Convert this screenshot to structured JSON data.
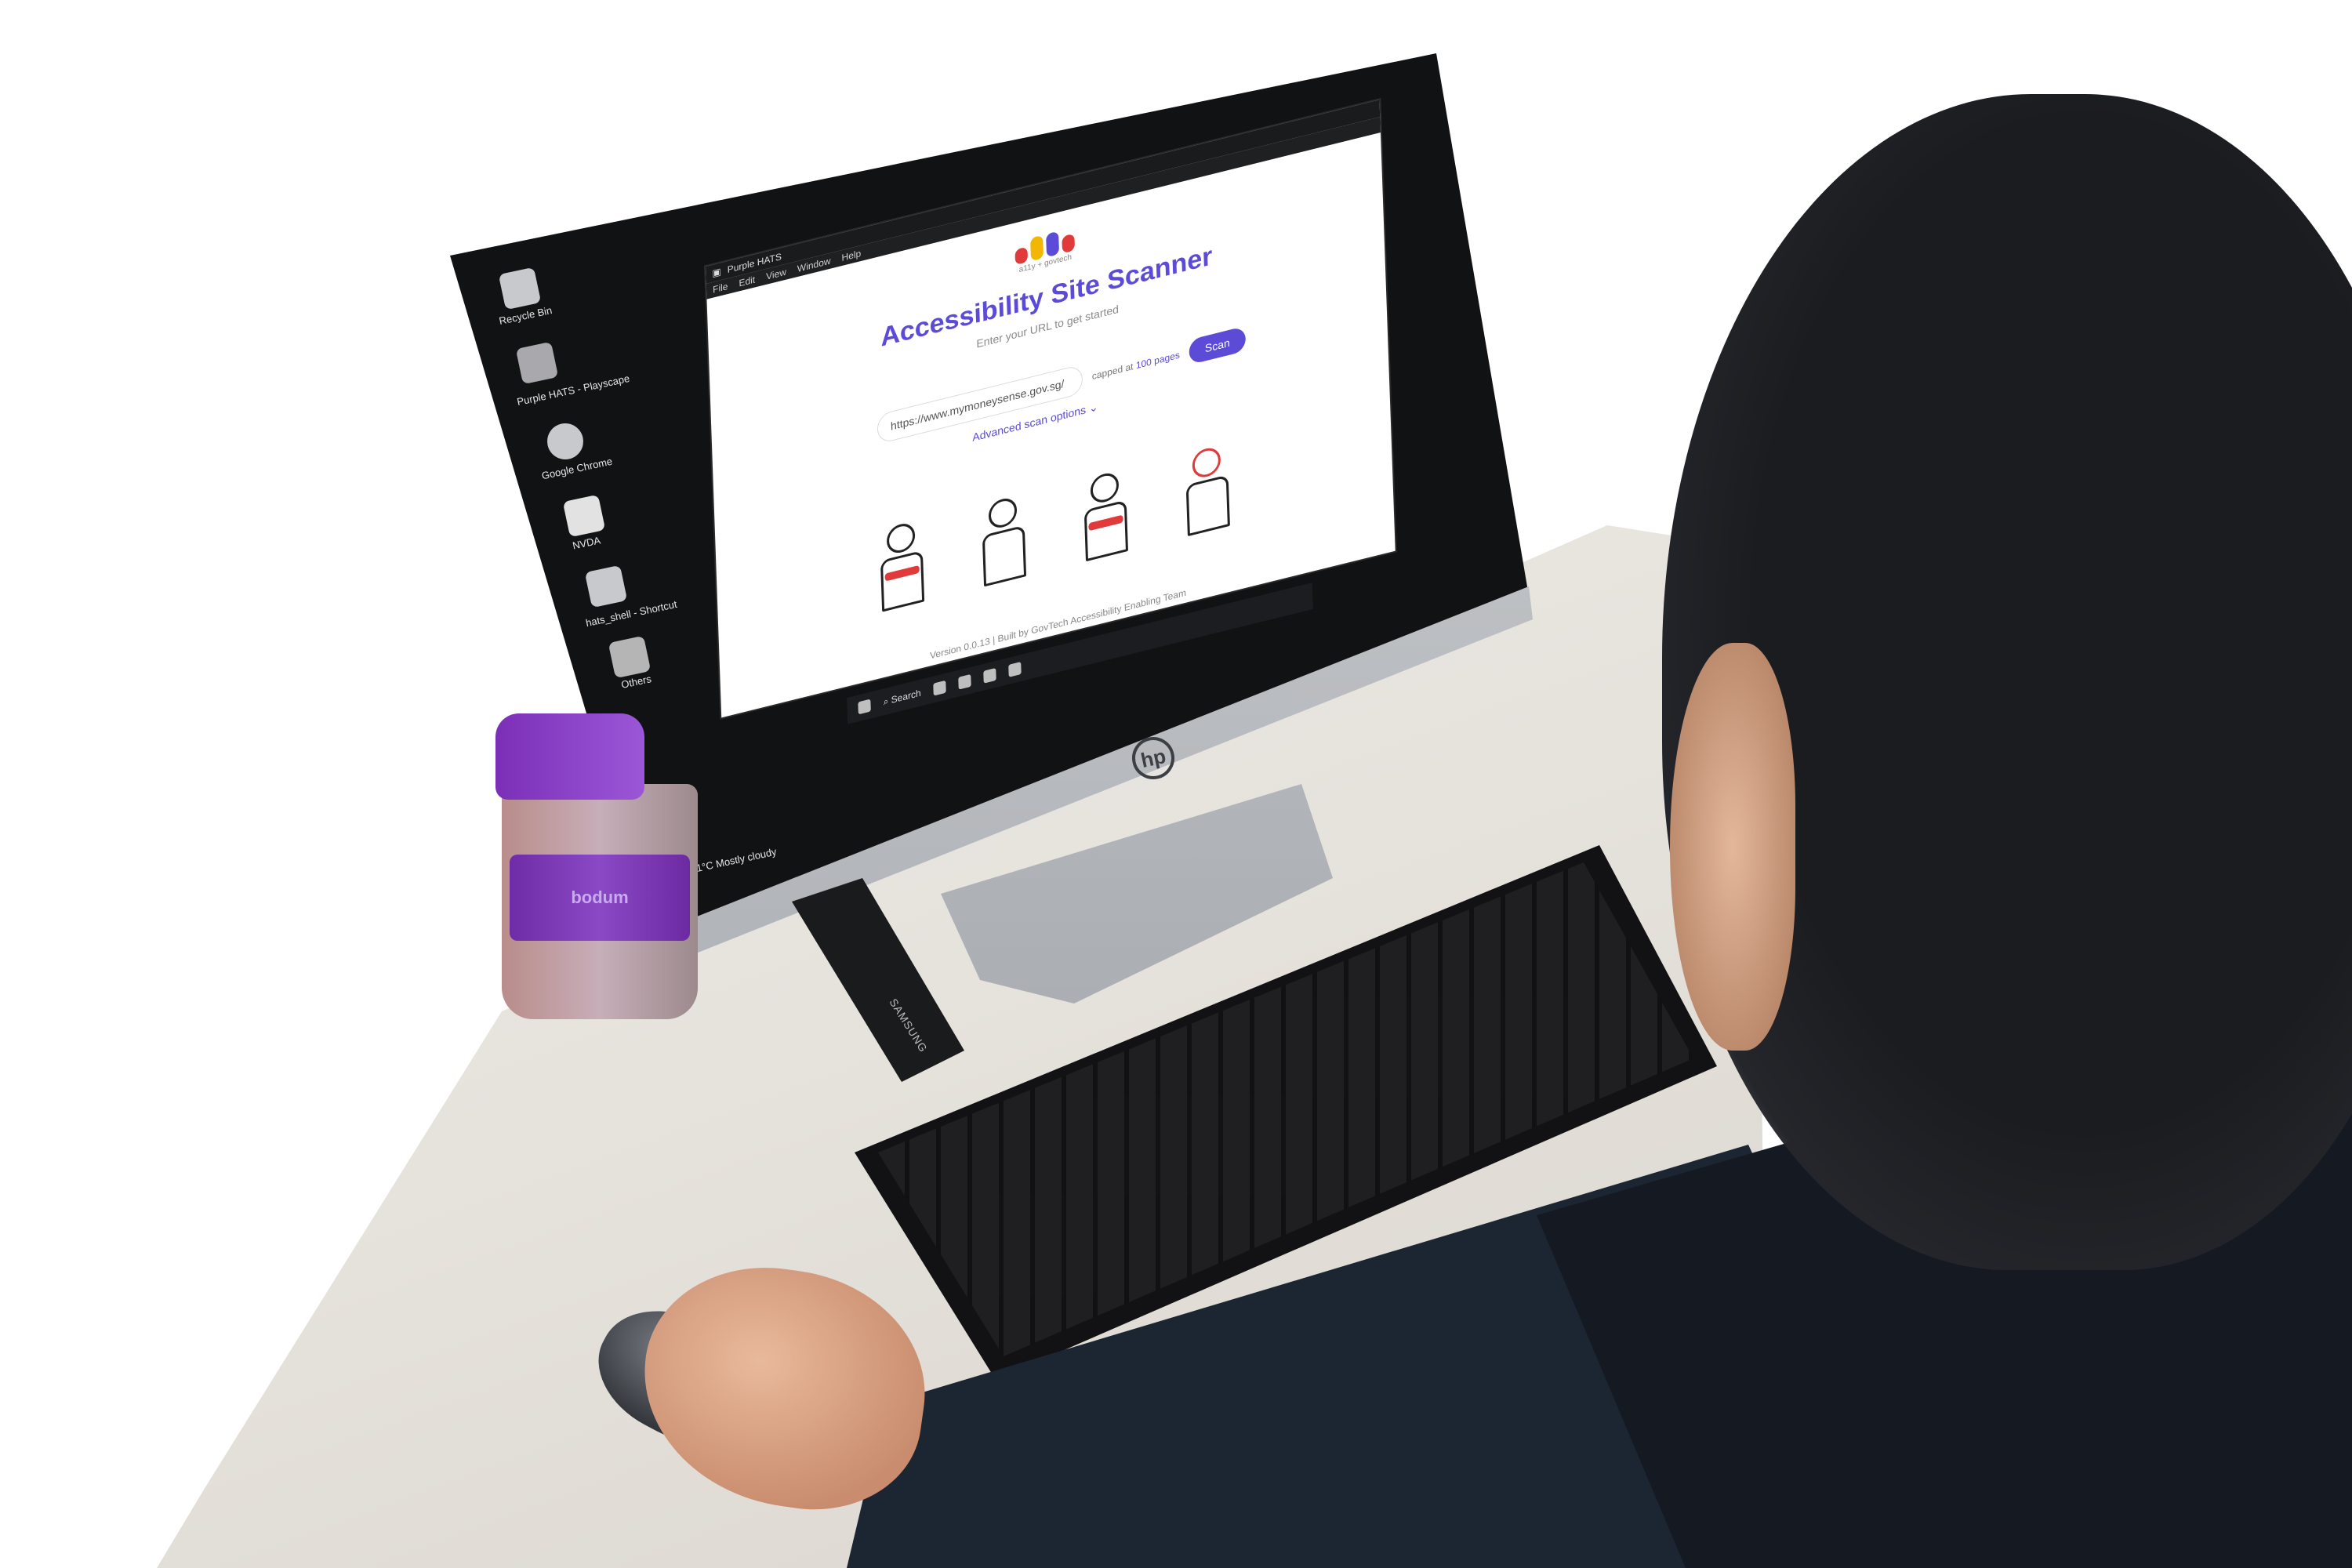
{
  "desktop": {
    "icons": [
      {
        "label": "Recycle Bin",
        "icon": "recycle-bin-icon"
      },
      {
        "label": "Purple HATS - Playscape",
        "icon": "purple-hats-icon"
      },
      {
        "label": "Google Chrome",
        "icon": "chrome-icon"
      },
      {
        "label": "NVDA",
        "icon": "nvda-icon"
      },
      {
        "label": "hats_shell - Shortcut",
        "icon": "shortcut-icon"
      },
      {
        "label": "Others",
        "icon": "folder-icon"
      }
    ],
    "weather": {
      "temp": "31°C",
      "desc": "Mostly cloudy"
    }
  },
  "app": {
    "window_title": "Purple HATS",
    "menu": [
      "File",
      "Edit",
      "View",
      "Window",
      "Help"
    ],
    "logo_colors": [
      "#e03a3a",
      "#f2b705",
      "#5b4bd7",
      "#e03a3a"
    ],
    "logo_sub": "a11y + govtech",
    "headline": "Accessibility Site Scanner",
    "hint": "Enter your URL to get started",
    "url_value": "https://www.mymoneysense.gov.sg/",
    "capped_prefix": "capped at",
    "capped_value": "100 pages",
    "scan_label": "Scan",
    "advanced_label": "Advanced scan options",
    "version": "Version 0.0.13 | Built by GovTech Accessibility Enabling Team",
    "accent": "#5b4bd7"
  },
  "taskbar": {
    "search_label": "Search"
  },
  "hardware": {
    "monitor_brand": "hp",
    "remote_brand": "SAMSUNG",
    "mug_text": "bodum"
  }
}
